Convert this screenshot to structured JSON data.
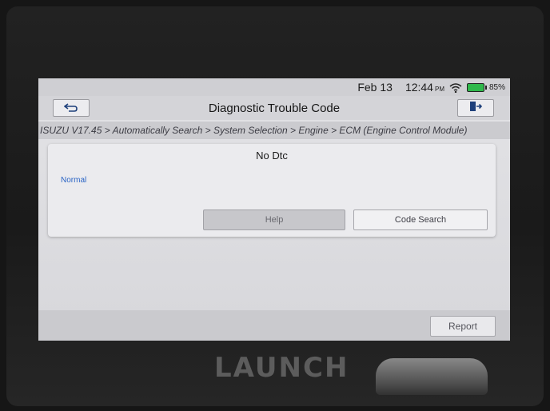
{
  "status_bar": {
    "date": "Feb 13",
    "time": "12:44",
    "ampm": "PM",
    "wifi_icon": "wifi-icon",
    "battery_icon": "battery-icon",
    "battery_percent": "85%",
    "battery_color": "#2fb84b"
  },
  "header": {
    "back_icon": "back-arrow-icon",
    "title": "Diagnostic Trouble Code",
    "exit_icon": "exit-door-icon"
  },
  "breadcrumb": "ISUZU V17.45 > Automatically Search > System Selection > Engine > ECM (Engine Control Module)",
  "dtc_panel": {
    "title": "No Dtc",
    "status": "Normal",
    "status_color": "#2a64c5",
    "help_label": "Help",
    "code_search_label": "Code Search"
  },
  "footer": {
    "report_label": "Report"
  },
  "device": {
    "brand_logo": "LAUNCH"
  }
}
